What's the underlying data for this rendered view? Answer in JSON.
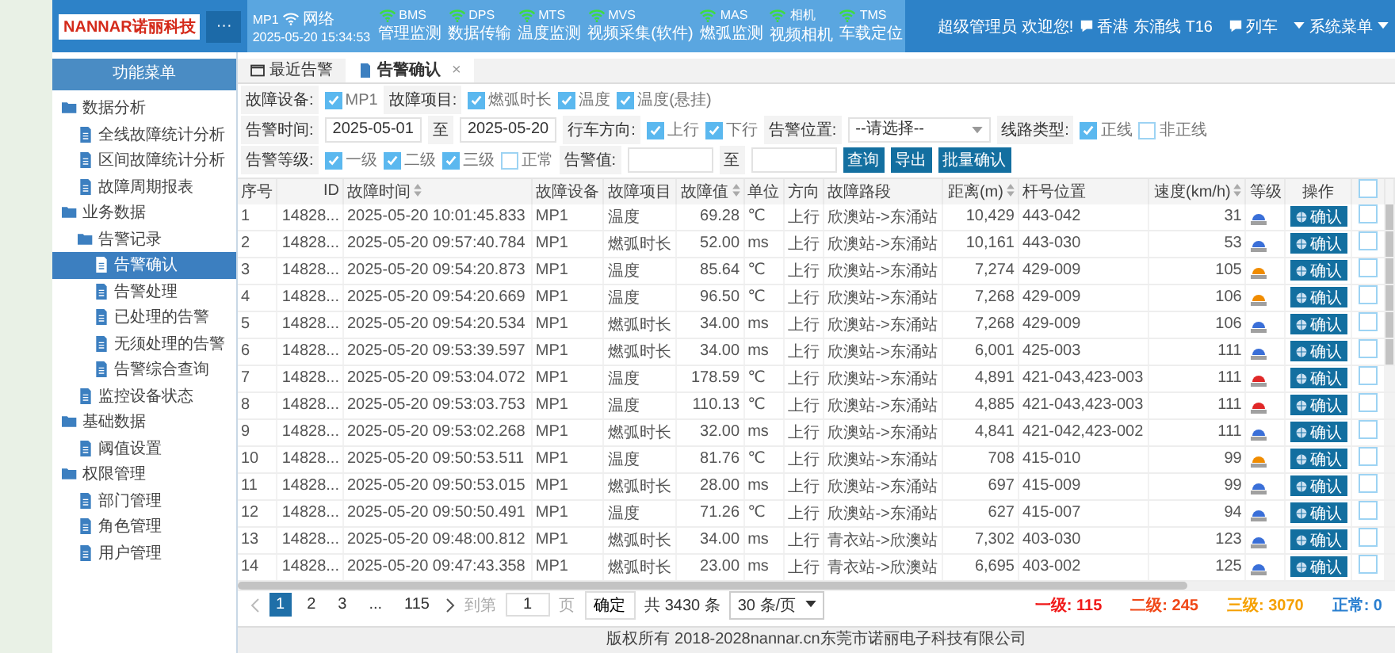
{
  "header": {
    "logo": "NANNAR诺丽科技",
    "menu_button": "···",
    "network": {
      "device": "MP1",
      "label": "网络",
      "time": "2025-05-20 15:34:53"
    },
    "systems": [
      {
        "code": "BMS",
        "label": "管理监测"
      },
      {
        "code": "DPS",
        "label": "数据传输"
      },
      {
        "code": "MTS",
        "label": "温度监测"
      },
      {
        "code": "MVS",
        "label": "视频采集(软件)"
      },
      {
        "code": "MAS",
        "label": "燃弧监测"
      },
      {
        "code": "相机",
        "label": "视频相机"
      },
      {
        "code": "TMS",
        "label": "车载定位"
      }
    ],
    "user": "超级管理员 欢迎您!",
    "line": "香港 东涌线 T16",
    "train": "列车",
    "system_menu": "系统菜单"
  },
  "sidebar": {
    "title": "功能菜单",
    "items": [
      {
        "label": "数据分析",
        "selected": false,
        "children": [
          {
            "label": "全线故障统计分析",
            "selected": false
          },
          {
            "label": "区间故障统计分析",
            "selected": false
          },
          {
            "label": "故障周期报表",
            "selected": false
          }
        ]
      },
      {
        "label": "业务数据",
        "selected": false,
        "children": [
          {
            "label": "告警记录",
            "selected": false,
            "children": [
              {
                "label": "告警确认",
                "selected": true
              },
              {
                "label": "告警处理",
                "selected": false
              },
              {
                "label": "已处理的告警",
                "selected": false
              },
              {
                "label": "无须处理的告警",
                "selected": false
              },
              {
                "label": "告警综合查询",
                "selected": false
              }
            ]
          },
          {
            "label": "监控设备状态",
            "selected": false
          }
        ]
      },
      {
        "label": "基础数据",
        "selected": false,
        "children": [
          {
            "label": "阈值设置",
            "selected": false
          }
        ]
      },
      {
        "label": "权限管理",
        "selected": false,
        "children": [
          {
            "label": "部门管理",
            "selected": false
          },
          {
            "label": "角色管理",
            "selected": false
          },
          {
            "label": "用户管理",
            "selected": false
          }
        ]
      }
    ]
  },
  "tabs": [
    {
      "label": "最近告警",
      "selected": false
    },
    {
      "label": "告警确认",
      "selected": true,
      "close": "×"
    }
  ],
  "filters": [
    [
      {
        "kind": "label",
        "text": "故障设备:"
      },
      {
        "kind": "checkbox",
        "text": "MP1",
        "checked": true
      },
      {
        "kind": "label",
        "text": "故障项目:"
      },
      {
        "kind": "checkbox",
        "text": "燃弧时长",
        "checked": true
      },
      {
        "kind": "checkbox",
        "text": "温度",
        "checked": true
      },
      {
        "kind": "checkbox",
        "text": "温度(悬挂)",
        "checked": true
      }
    ],
    [
      {
        "kind": "label",
        "text": "告警时间:"
      },
      {
        "kind": "field",
        "text": "2025-05-01"
      },
      {
        "kind": "sep",
        "text": "至"
      },
      {
        "kind": "field",
        "text": "2025-05-20"
      },
      {
        "kind": "label",
        "text": "行车方向:"
      },
      {
        "kind": "checkbox",
        "text": "上行",
        "checked": true
      },
      {
        "kind": "checkbox",
        "text": "下行",
        "checked": true
      },
      {
        "kind": "label",
        "text": "告警位置:"
      },
      {
        "kind": "select",
        "text": "--请选择--"
      },
      {
        "kind": "label",
        "text": "线路类型:"
      },
      {
        "kind": "checkbox",
        "text": "正线",
        "checked": true
      },
      {
        "kind": "checkbox",
        "text": "非正线",
        "checked": false
      }
    ],
    [
      {
        "kind": "label",
        "text": "告警等级:"
      },
      {
        "kind": "checkbox",
        "text": "一级",
        "checked": true
      },
      {
        "kind": "checkbox",
        "text": "二级",
        "checked": true
      },
      {
        "kind": "checkbox",
        "text": "三级",
        "checked": true
      },
      {
        "kind": "checkbox",
        "text": "正常",
        "checked": false
      },
      {
        "kind": "label",
        "text": "告警值:"
      },
      {
        "kind": "field"
      },
      {
        "kind": "sep",
        "text": "至"
      },
      {
        "kind": "field"
      },
      {
        "kind": "button",
        "text": "查询"
      },
      {
        "kind": "button",
        "text": "导出"
      },
      {
        "kind": "button",
        "text": "批量确认"
      }
    ]
  ],
  "table": {
    "columns": [
      {
        "label": "序号",
        "sortable": false
      },
      {
        "label": "ID",
        "sortable": false
      },
      {
        "label": "故障时间",
        "sortable": true
      },
      {
        "label": "故障设备",
        "sortable": false
      },
      {
        "label": "故障项目",
        "sortable": false
      },
      {
        "label": "故障值",
        "sortable": true
      },
      {
        "label": "单位",
        "sortable": false
      },
      {
        "label": "方向",
        "sortable": false
      },
      {
        "label": "故障路段",
        "sortable": false
      },
      {
        "label": "距离(m)",
        "sortable": true
      },
      {
        "label": "杆号位置",
        "sortable": false
      },
      {
        "label": "速度(km/h)",
        "sortable": true
      },
      {
        "label": "等级",
        "sortable": false
      },
      {
        "label": "操作",
        "sortable": false
      }
    ],
    "select_all": false,
    "rows": [
      {
        "cells": [
          "1",
          "14828...",
          "2025-05-20 10:01:45.833",
          "MP1",
          "温度",
          "69.28",
          "℃",
          "上行",
          "欣澳站->东涌站",
          "10,429",
          "443-042",
          "31"
        ],
        "color": "#3a6fd8",
        "action": "确认",
        "checked": false
      },
      {
        "cells": [
          "2",
          "14828...",
          "2025-05-20 09:57:40.784",
          "MP1",
          "燃弧时长",
          "52.00",
          "ms",
          "上行",
          "欣澳站->东涌站",
          "10,161",
          "443-030",
          "53"
        ],
        "color": "#3a6fd8",
        "action": "确认",
        "checked": false
      },
      {
        "cells": [
          "3",
          "14828...",
          "2025-05-20 09:54:20.873",
          "MP1",
          "温度",
          "85.64",
          "℃",
          "上行",
          "欣澳站->东涌站",
          "7,274",
          "429-009",
          "105"
        ],
        "color": "#f08c00",
        "action": "确认",
        "checked": false
      },
      {
        "cells": [
          "4",
          "14828...",
          "2025-05-20 09:54:20.669",
          "MP1",
          "温度",
          "96.50",
          "℃",
          "上行",
          "欣澳站->东涌站",
          "7,268",
          "429-009",
          "106"
        ],
        "color": "#f08c00",
        "action": "确认",
        "checked": false
      },
      {
        "cells": [
          "5",
          "14828...",
          "2025-05-20 09:54:20.534",
          "MP1",
          "燃弧时长",
          "34.00",
          "ms",
          "上行",
          "欣澳站->东涌站",
          "7,268",
          "429-009",
          "106"
        ],
        "color": "#3a6fd8",
        "action": "确认",
        "checked": false
      },
      {
        "cells": [
          "6",
          "14828...",
          "2025-05-20 09:53:39.597",
          "MP1",
          "燃弧时长",
          "34.00",
          "ms",
          "上行",
          "欣澳站->东涌站",
          "6,001",
          "425-003",
          "111"
        ],
        "color": "#3a6fd8",
        "action": "确认",
        "checked": false
      },
      {
        "cells": [
          "7",
          "14828...",
          "2025-05-20 09:53:04.072",
          "MP1",
          "温度",
          "178.59",
          "℃",
          "上行",
          "欣澳站->东涌站",
          "4,891",
          "421-043,423-003",
          "111"
        ],
        "color": "#e02828",
        "action": "确认",
        "checked": false
      },
      {
        "cells": [
          "8",
          "14828...",
          "2025-05-20 09:53:03.753",
          "MP1",
          "温度",
          "110.13",
          "℃",
          "上行",
          "欣澳站->东涌站",
          "4,885",
          "421-043,423-003",
          "111"
        ],
        "color": "#e02828",
        "action": "确认",
        "checked": false
      },
      {
        "cells": [
          "9",
          "14828...",
          "2025-05-20 09:53:02.268",
          "MP1",
          "燃弧时长",
          "32.00",
          "ms",
          "上行",
          "欣澳站->东涌站",
          "4,841",
          "421-042,423-002",
          "111"
        ],
        "color": "#3a6fd8",
        "action": "确认",
        "checked": false
      },
      {
        "cells": [
          "10",
          "14828...",
          "2025-05-20 09:50:53.511",
          "MP1",
          "温度",
          "81.76",
          "℃",
          "上行",
          "欣澳站->东涌站",
          "708",
          "415-010",
          "99"
        ],
        "color": "#f08c00",
        "action": "确认",
        "checked": false
      },
      {
        "cells": [
          "11",
          "14828...",
          "2025-05-20 09:50:53.015",
          "MP1",
          "燃弧时长",
          "28.00",
          "ms",
          "上行",
          "欣澳站->东涌站",
          "697",
          "415-009",
          "99"
        ],
        "color": "#3a6fd8",
        "action": "确认",
        "checked": false
      },
      {
        "cells": [
          "12",
          "14828...",
          "2025-05-20 09:50:50.491",
          "MP1",
          "温度",
          "71.26",
          "℃",
          "上行",
          "欣澳站->东涌站",
          "627",
          "415-007",
          "94"
        ],
        "color": "#3a6fd8",
        "action": "确认",
        "checked": false
      },
      {
        "cells": [
          "13",
          "14828...",
          "2025-05-20 09:48:00.812",
          "MP1",
          "燃弧时长",
          "34.00",
          "ms",
          "上行",
          "青衣站->欣澳站",
          "7,302",
          "403-030",
          "123"
        ],
        "color": "#3a6fd8",
        "action": "确认",
        "checked": false
      },
      {
        "cells": [
          "14",
          "14828...",
          "2025-05-20 09:47:43.358",
          "MP1",
          "燃弧时长",
          "23.00",
          "ms",
          "上行",
          "青衣站->欣澳站",
          "6,695",
          "403-002",
          "125"
        ],
        "color": "#3a6fd8",
        "action": "确认",
        "checked": false
      }
    ]
  },
  "pagination": {
    "pages": [
      {
        "label": "1",
        "selected": true
      },
      {
        "label": "2",
        "selected": false
      },
      {
        "label": "3",
        "selected": false
      },
      {
        "label": "...",
        "selected": false
      },
      {
        "label": "115",
        "selected": false
      }
    ],
    "goto_label": "到第",
    "goto_value": "1",
    "page_unit": "页",
    "confirm": "确定",
    "total": "共 3430 条",
    "page_size": "30 条/页"
  },
  "counts": [
    {
      "label": "一级:",
      "value": "115",
      "color": "#f01818"
    },
    {
      "label": "二级:",
      "value": "245",
      "color": "#f04818"
    },
    {
      "label": "三级:",
      "value": "3070",
      "color": "#f5a000"
    },
    {
      "label": "正常:",
      "value": "0",
      "color": "#2a7fd0"
    }
  ],
  "footer": "版权所有 2018-2028nannar.cn东莞市诺丽电子科技有限公司"
}
